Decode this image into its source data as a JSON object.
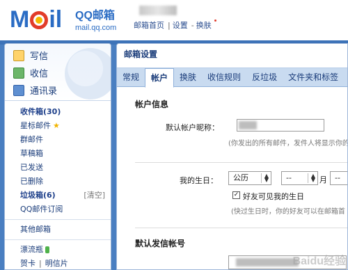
{
  "header": {
    "logo_text_left": "M",
    "logo_text_right": "il",
    "brand_name": "QQ邮箱",
    "brand_url": "mail.qq.com",
    "top_links": [
      "邮箱首页",
      "设置",
      "换肤"
    ]
  },
  "sidebar": {
    "quick": [
      {
        "label": "写信",
        "icon": "write-icon"
      },
      {
        "label": "收信",
        "icon": "inbox-download-icon"
      },
      {
        "label": "通讯录",
        "icon": "contacts-icon"
      }
    ],
    "folders": [
      {
        "label": "收件箱(30)",
        "bold": true
      },
      {
        "label": "星标邮件",
        "star": true
      },
      {
        "label": "群邮件"
      },
      {
        "label": "草稿箱"
      },
      {
        "label": "已发送"
      },
      {
        "label": "已删除"
      },
      {
        "label": "垃圾箱(6)",
        "bold": true,
        "extra": "[清空]"
      },
      {
        "label": "QQ邮件订阅"
      }
    ],
    "other": "其他邮箱",
    "bottle": "漂流瓶",
    "cards": "贺卡",
    "postcard": "明信片"
  },
  "main": {
    "title": "邮箱设置",
    "tabs": [
      "常规",
      "帐户",
      "换肤",
      "收信规则",
      "反垃圾",
      "文件夹和标签"
    ],
    "active_tab": 1,
    "account_section": "帐户信息",
    "nickname_label": "默认帐户昵称：",
    "nickname_hint": "(你发出的所有邮件，发件人将显示你的",
    "birthday_label": "我的生日：",
    "calendar_value": "公历",
    "month_value": "--",
    "month_unit": "月",
    "day_value": "--",
    "friends_visible_label": "好友可见我的生日",
    "friends_visible_checked": true,
    "birthday_hint": "(快过生日时，你的好友可以在邮箱首",
    "sender_section": "默认发信帐号",
    "watermark": "Baidu经验"
  }
}
